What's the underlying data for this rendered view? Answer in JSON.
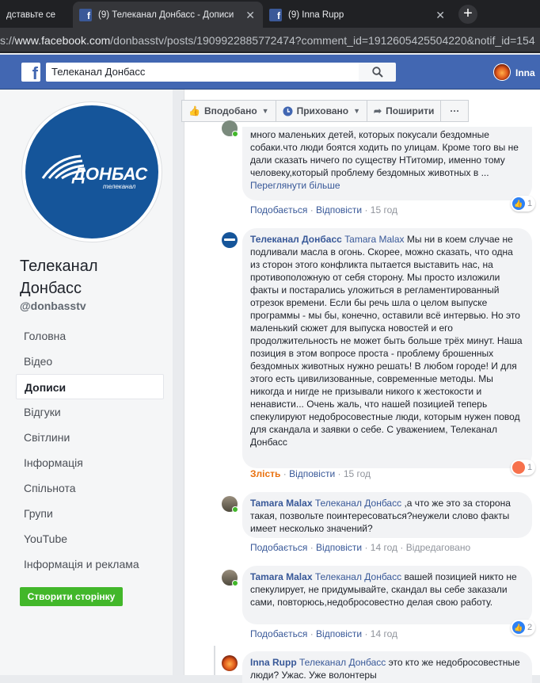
{
  "browser": {
    "tabs": [
      {
        "title": "дставьте се"
      },
      {
        "title": "(9) Телеканал Донбасс - Дописи"
      },
      {
        "title": "(9) Inna Rupp"
      }
    ],
    "url_prefix": "s://",
    "url_host": "www.facebook.com",
    "url_path": "/donbasstv/posts/1909922885772474?comment_id=1912605425504220&notif_id=154"
  },
  "fb_header": {
    "logo": "f",
    "search_value": "Телеканал Донбасс",
    "user_name": "Inna"
  },
  "page": {
    "logo_text": "ДОНБАС",
    "logo_subtext": "телеканал",
    "name": "Телеканал Донбасс",
    "handle": "@donbasstv",
    "nav": [
      {
        "label": "Головна"
      },
      {
        "label": "Відео"
      },
      {
        "label": "Дописи"
      },
      {
        "label": "Відгуки"
      },
      {
        "label": "Світлини"
      },
      {
        "label": "Інформація"
      },
      {
        "label": "Спільнота"
      },
      {
        "label": "Групи"
      },
      {
        "label": "YouTube"
      },
      {
        "label": "Інформація и реклама"
      }
    ],
    "create_page_button": "Створити сторінку"
  },
  "actions": {
    "liked": "Вподобано",
    "hidden": "Приховано",
    "share": "Поширити",
    "more": "···"
  },
  "comments": [
    {
      "text": "много маленьких детей, которых покусали бездомные собаки.что люди боятся ходить по улицам. Кроме того вы не дали сказать ничего по существу НТитомир, именно тому человеку,который проблему бездомных животных в ...",
      "see_more": "Переглянути більше",
      "like": "Подобається",
      "reply": "Відповісти",
      "time": "15 год",
      "reaction_count": "1"
    },
    {
      "author": "Телеканал Донбасс",
      "mention": "Tamara Malax",
      "text": "Мы ни в коем случае не подливали масла в огонь. Скорее, можно сказать, что одна из сторон этого конфликта пытается выставить нас, на противоположную от себя сторону. Мы просто изложили факты и постарались уложиться в регламентированный отрезок времени. Если бы речь шла о целом выпуске программы - мы бы, конечно, оставили всё интервью. Но это маленький сюжет для выпуска новостей и его продолжительность не может быть больше трёх минут. Наша позиция в этом вопросе проста - проблему брошенных бездомных животных нужно решать! В любом городе! И для этого есть цивилизованные, современные методы. Мы никогда и нигде не призывали никого к жестокости и ненависти... Очень жаль, что нашей позицией теперь спекулируют недобросовестные люди, которым нужен повод для скандала и заявки о себе. С уважением, Телеканал Донбасс",
      "like": "Злість",
      "reply": "Відповісти",
      "time": "15 год",
      "reaction_count": "1"
    },
    {
      "author": "Tamara Malax",
      "mention": "Телеканал Донбасс",
      "text": ",а что же это за сторона такая, позвольте поинтересоваться?неужели слово факты имеет несколько значений?",
      "like": "Подобається",
      "reply": "Відповісти",
      "time": "14 год",
      "edited": "Відредаговано"
    },
    {
      "author": "Tamara Malax",
      "mention": "Телеканал Донбасс",
      "text": "вашей позицией никто не спекулирует, не придумывайте, скандал вы себе заказали сами, повторюсь,недобросовестно делая свою работу.",
      "like": "Подобається",
      "reply": "Відповісти",
      "time": "14 год",
      "reaction_count": "2"
    },
    {
      "author": "Inna Rupp",
      "mention": "Телеканал Донбасс",
      "text": "это кто же недобросовестные люди? Ужас. Уже волонтеры"
    }
  ],
  "colors": {
    "fb_blue": "#4267b2",
    "link": "#385898",
    "green": "#42b72a"
  }
}
